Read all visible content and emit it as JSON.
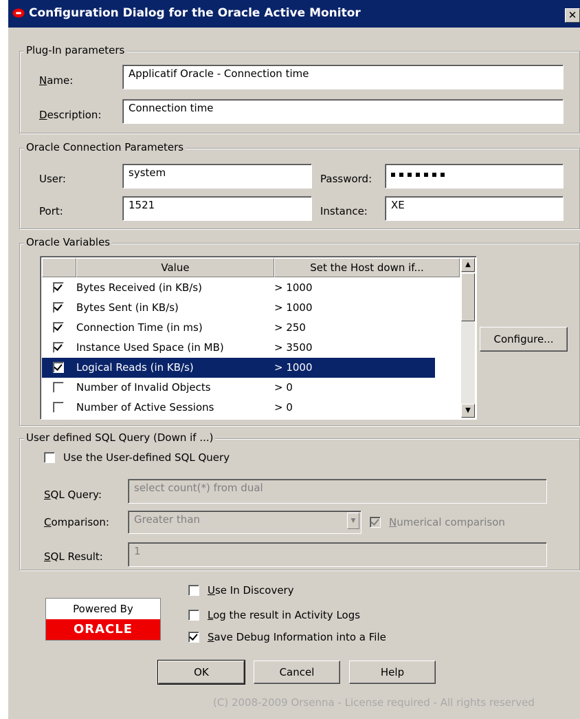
{
  "window": {
    "title": "Configuration Dialog for the Oracle Active Monitor",
    "close_symbol": "✕"
  },
  "plugin": {
    "group_label": "Plug-In parameters",
    "name_label_u": "N",
    "name_label_rest": "ame:",
    "name_value": "Applicatif Oracle - Connection time",
    "desc_label_u": "D",
    "desc_label_rest": "escription:",
    "desc_value": "Connection time"
  },
  "connection": {
    "group_label": "Oracle Connection Parameters",
    "user_label": "User:",
    "user_value": "system",
    "password_label": "Password:",
    "port_label": "Port:",
    "port_value": "1521",
    "instance_label": "Instance:",
    "instance_value": "XE"
  },
  "variables": {
    "group_label": "Oracle Variables",
    "col_value": "Value",
    "col_condition": "Set the Host down if...",
    "rows": [
      {
        "checked": true,
        "value": "Bytes Received (in KB/s)",
        "condition": "> 1000"
      },
      {
        "checked": true,
        "value": "Bytes Sent (in KB/s)",
        "condition": "> 1000"
      },
      {
        "checked": true,
        "value": "Connection Time (in ms)",
        "condition": "> 250"
      },
      {
        "checked": true,
        "value": "Instance Used Space (in MB)",
        "condition": "> 3500"
      },
      {
        "checked": true,
        "value": "Logical Reads (in KB/s)",
        "condition": "> 1000",
        "selected": true
      },
      {
        "checked": false,
        "value": "Number of Invalid Objects",
        "condition": "> 0"
      },
      {
        "checked": false,
        "value": "Number of Active Sessions",
        "condition": "> 0"
      }
    ],
    "configure_button": "Configure..."
  },
  "sql": {
    "group_label": "User defined SQL Query (Down if ...)",
    "use_label": "Use the User-defined SQL Query",
    "query_label_u": "S",
    "query_label_rest": "QL Query:",
    "query_value": "select count(*) from dual",
    "comparison_label_u": "C",
    "comparison_label_rest": "omparison:",
    "comparison_value": "Greater than",
    "numerical_label_u": "N",
    "numerical_label_rest": "umerical comparison",
    "result_label_u": "S",
    "result_label_rest": "QL Result:",
    "result_value": "1"
  },
  "logo": {
    "powered_by": "Powered By",
    "brand": "ORACLE"
  },
  "options": {
    "discovery_u": "U",
    "discovery_rest": "se In Discovery",
    "log_u": "L",
    "log_rest": "og the result in Activity Logs",
    "debug_u": "S",
    "debug_rest": "ave Debug Information into a File"
  },
  "buttons": {
    "ok": "OK",
    "cancel": "Cancel",
    "help": "Help"
  },
  "footer": "(C) 2008-2009 Orsenna - License required - All rights reserved"
}
